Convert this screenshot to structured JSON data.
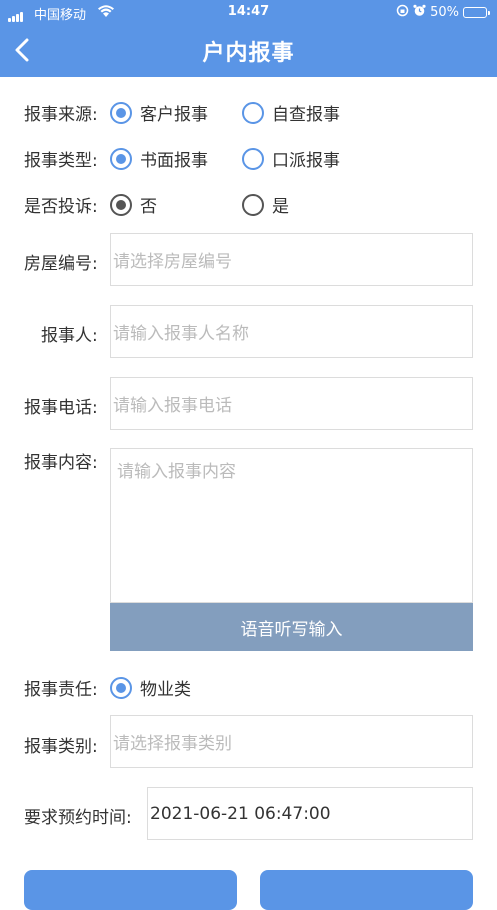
{
  "status_bar": {
    "carrier": "中国移动",
    "time": "14:47",
    "battery": "50%",
    "battery_level": 0.5
  },
  "header": {
    "title": "户内报事"
  },
  "form": {
    "source": {
      "label": "报事来源:",
      "options": [
        {
          "label": "客户报事",
          "selected": true
        },
        {
          "label": "自查报事",
          "selected": false
        }
      ]
    },
    "type": {
      "label": "报事类型:",
      "options": [
        {
          "label": "书面报事",
          "selected": true
        },
        {
          "label": "口派报事",
          "selected": false
        }
      ]
    },
    "complaint": {
      "label": "是否投诉:",
      "options": [
        {
          "label": "否",
          "selected": true
        },
        {
          "label": "是",
          "selected": false
        }
      ]
    },
    "house_no": {
      "label": "房屋编号:",
      "placeholder": "请选择房屋编号"
    },
    "reporter": {
      "label": "报事人:",
      "placeholder": "请输入报事人名称"
    },
    "phone": {
      "label": "报事电话:",
      "placeholder": "请输入报事电话"
    },
    "content": {
      "label": "报事内容:",
      "placeholder": "请输入报事内容"
    },
    "voice_button": "语音听写输入",
    "responsibility": {
      "label": "报事责任:",
      "options": [
        {
          "label": "物业类",
          "selected": true
        }
      ]
    },
    "category": {
      "label": "报事类别:",
      "placeholder": "请选择报事类别"
    },
    "appointment": {
      "label": "要求预约时间:",
      "value": "2021-06-21 06:47:00"
    }
  }
}
